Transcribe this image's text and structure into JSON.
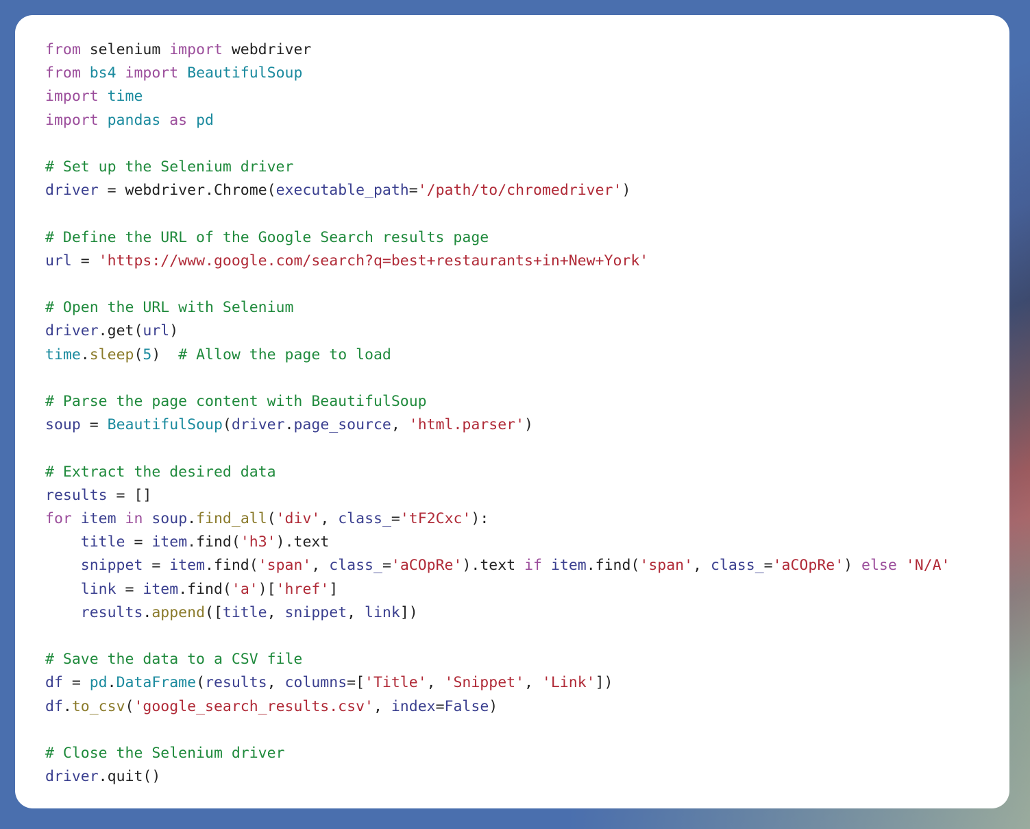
{
  "card": {
    "language": "python",
    "background_color": "#ffffff",
    "corner_radius_px": 26
  },
  "theme": {
    "comment_color": "#1f8a3c",
    "keyword_color": "#9b4d9b",
    "module_color": "#1a8a9e",
    "variable_color": "#3a3f8f",
    "string_color": "#b02a37",
    "function_color": "#8a7a2a",
    "kwarg_color": "#3a3f8f",
    "plain_color": "#222222",
    "page_gradient_start": "#4a6fae",
    "page_gradient_mid": "#9b5a5e",
    "page_gradient_end": "#9aab9e"
  },
  "code": {
    "lines": [
      {
        "id": "l1",
        "tokens": [
          {
            "t": "from ",
            "c": "kw"
          },
          {
            "t": "selenium ",
            "c": "pl"
          },
          {
            "t": "import ",
            "c": "kw"
          },
          {
            "t": "webdriver",
            "c": "pl"
          }
        ]
      },
      {
        "id": "l2",
        "tokens": [
          {
            "t": "from ",
            "c": "kw"
          },
          {
            "t": "bs4 ",
            "c": "mod"
          },
          {
            "t": "import ",
            "c": "kw"
          },
          {
            "t": "BeautifulSoup",
            "c": "mod"
          }
        ]
      },
      {
        "id": "l3",
        "tokens": [
          {
            "t": "import ",
            "c": "kw"
          },
          {
            "t": "time",
            "c": "mod"
          }
        ]
      },
      {
        "id": "l4",
        "tokens": [
          {
            "t": "import ",
            "c": "kw"
          },
          {
            "t": "pandas ",
            "c": "mod"
          },
          {
            "t": "as ",
            "c": "kw"
          },
          {
            "t": "pd",
            "c": "mod"
          }
        ]
      },
      {
        "id": "l5",
        "tokens": []
      },
      {
        "id": "l6",
        "tokens": [
          {
            "t": "# Set up the Selenium driver",
            "c": "cm"
          }
        ]
      },
      {
        "id": "l7",
        "tokens": [
          {
            "t": "driver",
            "c": "var"
          },
          {
            "t": " = ",
            "c": "pl"
          },
          {
            "t": "webdriver",
            "c": "pl"
          },
          {
            "t": ".",
            "c": "pl"
          },
          {
            "t": "Chrome",
            "c": "pl"
          },
          {
            "t": "(",
            "c": "pl"
          },
          {
            "t": "executable_path",
            "c": "kwa"
          },
          {
            "t": "=",
            "c": "pl"
          },
          {
            "t": "'/path/to/chromedriver'",
            "c": "str"
          },
          {
            "t": ")",
            "c": "pl"
          }
        ]
      },
      {
        "id": "l8",
        "tokens": []
      },
      {
        "id": "l9",
        "tokens": [
          {
            "t": "# Define the URL of the Google Search results page",
            "c": "cm"
          }
        ]
      },
      {
        "id": "l10",
        "tokens": [
          {
            "t": "url",
            "c": "var"
          },
          {
            "t": " = ",
            "c": "pl"
          },
          {
            "t": "'https://www.google.com/search?q=best+restaurants+in+New+York'",
            "c": "str"
          }
        ]
      },
      {
        "id": "l11",
        "tokens": []
      },
      {
        "id": "l12",
        "tokens": [
          {
            "t": "# Open the URL with Selenium",
            "c": "cm"
          }
        ]
      },
      {
        "id": "l13",
        "tokens": [
          {
            "t": "driver",
            "c": "var"
          },
          {
            "t": ".",
            "c": "pl"
          },
          {
            "t": "get",
            "c": "pl"
          },
          {
            "t": "(",
            "c": "pl"
          },
          {
            "t": "url",
            "c": "var"
          },
          {
            "t": ")",
            "c": "pl"
          }
        ]
      },
      {
        "id": "l14",
        "tokens": [
          {
            "t": "time",
            "c": "mod"
          },
          {
            "t": ".",
            "c": "pl"
          },
          {
            "t": "sleep",
            "c": "fn"
          },
          {
            "t": "(",
            "c": "pl"
          },
          {
            "t": "5",
            "c": "mod"
          },
          {
            "t": ")",
            "c": "pl"
          },
          {
            "t": "  ",
            "c": "pl"
          },
          {
            "t": "# Allow the page to load",
            "c": "cm"
          }
        ]
      },
      {
        "id": "l15",
        "tokens": []
      },
      {
        "id": "l16",
        "tokens": [
          {
            "t": "# Parse the page content with BeautifulSoup",
            "c": "cm"
          }
        ]
      },
      {
        "id": "l17",
        "tokens": [
          {
            "t": "soup",
            "c": "var"
          },
          {
            "t": " = ",
            "c": "pl"
          },
          {
            "t": "BeautifulSoup",
            "c": "mod"
          },
          {
            "t": "(",
            "c": "pl"
          },
          {
            "t": "driver",
            "c": "var"
          },
          {
            "t": ".",
            "c": "pl"
          },
          {
            "t": "page_source",
            "c": "var"
          },
          {
            "t": ", ",
            "c": "pl"
          },
          {
            "t": "'html.parser'",
            "c": "str"
          },
          {
            "t": ")",
            "c": "pl"
          }
        ]
      },
      {
        "id": "l18",
        "tokens": []
      },
      {
        "id": "l19",
        "tokens": [
          {
            "t": "# Extract the desired data",
            "c": "cm"
          }
        ]
      },
      {
        "id": "l20",
        "tokens": [
          {
            "t": "results",
            "c": "var"
          },
          {
            "t": " = []",
            "c": "pl"
          }
        ]
      },
      {
        "id": "l21",
        "tokens": [
          {
            "t": "for ",
            "c": "kw"
          },
          {
            "t": "item",
            "c": "var"
          },
          {
            "t": " ",
            "c": "pl"
          },
          {
            "t": "in ",
            "c": "kw"
          },
          {
            "t": "soup",
            "c": "var"
          },
          {
            "t": ".",
            "c": "pl"
          },
          {
            "t": "find_all",
            "c": "fn"
          },
          {
            "t": "(",
            "c": "pl"
          },
          {
            "t": "'div'",
            "c": "str"
          },
          {
            "t": ", ",
            "c": "pl"
          },
          {
            "t": "class_",
            "c": "kwa"
          },
          {
            "t": "=",
            "c": "pl"
          },
          {
            "t": "'tF2Cxc'",
            "c": "str"
          },
          {
            "t": "):",
            "c": "pl"
          }
        ]
      },
      {
        "id": "l22",
        "tokens": [
          {
            "t": "    ",
            "c": "pl"
          },
          {
            "t": "title",
            "c": "var"
          },
          {
            "t": " = ",
            "c": "pl"
          },
          {
            "t": "item",
            "c": "var"
          },
          {
            "t": ".",
            "c": "pl"
          },
          {
            "t": "find",
            "c": "pl"
          },
          {
            "t": "(",
            "c": "pl"
          },
          {
            "t": "'h3'",
            "c": "str"
          },
          {
            "t": ")",
            "c": "pl"
          },
          {
            "t": ".",
            "c": "pl"
          },
          {
            "t": "text",
            "c": "pl"
          }
        ]
      },
      {
        "id": "l23",
        "tokens": [
          {
            "t": "    ",
            "c": "pl"
          },
          {
            "t": "snippet",
            "c": "var"
          },
          {
            "t": " = ",
            "c": "pl"
          },
          {
            "t": "item",
            "c": "var"
          },
          {
            "t": ".",
            "c": "pl"
          },
          {
            "t": "find",
            "c": "pl"
          },
          {
            "t": "(",
            "c": "pl"
          },
          {
            "t": "'span'",
            "c": "str"
          },
          {
            "t": ", ",
            "c": "pl"
          },
          {
            "t": "class_",
            "c": "kwa"
          },
          {
            "t": "=",
            "c": "pl"
          },
          {
            "t": "'aCOpRe'",
            "c": "str"
          },
          {
            "t": ")",
            "c": "pl"
          },
          {
            "t": ".",
            "c": "pl"
          },
          {
            "t": "text ",
            "c": "pl"
          },
          {
            "t": "if ",
            "c": "kw"
          },
          {
            "t": "item",
            "c": "var"
          },
          {
            "t": ".",
            "c": "pl"
          },
          {
            "t": "find",
            "c": "pl"
          },
          {
            "t": "(",
            "c": "pl"
          },
          {
            "t": "'span'",
            "c": "str"
          },
          {
            "t": ", ",
            "c": "pl"
          },
          {
            "t": "class_",
            "c": "kwa"
          },
          {
            "t": "=",
            "c": "pl"
          },
          {
            "t": "'aCOpRe'",
            "c": "str"
          },
          {
            "t": ") ",
            "c": "pl"
          },
          {
            "t": "else ",
            "c": "kw"
          },
          {
            "t": "'N/A'",
            "c": "str"
          }
        ]
      },
      {
        "id": "l24",
        "tokens": [
          {
            "t": "    ",
            "c": "pl"
          },
          {
            "t": "link",
            "c": "var"
          },
          {
            "t": " = ",
            "c": "pl"
          },
          {
            "t": "item",
            "c": "var"
          },
          {
            "t": ".",
            "c": "pl"
          },
          {
            "t": "find",
            "c": "pl"
          },
          {
            "t": "(",
            "c": "pl"
          },
          {
            "t": "'a'",
            "c": "str"
          },
          {
            "t": ")[",
            "c": "pl"
          },
          {
            "t": "'href'",
            "c": "str"
          },
          {
            "t": "]",
            "c": "pl"
          }
        ]
      },
      {
        "id": "l25",
        "tokens": [
          {
            "t": "    ",
            "c": "pl"
          },
          {
            "t": "results",
            "c": "var"
          },
          {
            "t": ".",
            "c": "pl"
          },
          {
            "t": "append",
            "c": "fn"
          },
          {
            "t": "([",
            "c": "pl"
          },
          {
            "t": "title",
            "c": "var"
          },
          {
            "t": ", ",
            "c": "pl"
          },
          {
            "t": "snippet",
            "c": "var"
          },
          {
            "t": ", ",
            "c": "pl"
          },
          {
            "t": "link",
            "c": "var"
          },
          {
            "t": "])",
            "c": "pl"
          }
        ]
      },
      {
        "id": "l26",
        "tokens": []
      },
      {
        "id": "l27",
        "tokens": [
          {
            "t": "# Save the data to a CSV file",
            "c": "cm"
          }
        ]
      },
      {
        "id": "l28",
        "tokens": [
          {
            "t": "df",
            "c": "var"
          },
          {
            "t": " = ",
            "c": "pl"
          },
          {
            "t": "pd",
            "c": "mod"
          },
          {
            "t": ".",
            "c": "pl"
          },
          {
            "t": "DataFrame",
            "c": "mod"
          },
          {
            "t": "(",
            "c": "pl"
          },
          {
            "t": "results",
            "c": "var"
          },
          {
            "t": ", ",
            "c": "pl"
          },
          {
            "t": "columns",
            "c": "kwa"
          },
          {
            "t": "=[",
            "c": "pl"
          },
          {
            "t": "'Title'",
            "c": "str"
          },
          {
            "t": ", ",
            "c": "pl"
          },
          {
            "t": "'Snippet'",
            "c": "str"
          },
          {
            "t": ", ",
            "c": "pl"
          },
          {
            "t": "'Link'",
            "c": "str"
          },
          {
            "t": "])",
            "c": "pl"
          }
        ]
      },
      {
        "id": "l29",
        "tokens": [
          {
            "t": "df",
            "c": "var"
          },
          {
            "t": ".",
            "c": "pl"
          },
          {
            "t": "to_csv",
            "c": "fn"
          },
          {
            "t": "(",
            "c": "pl"
          },
          {
            "t": "'google_search_results.csv'",
            "c": "str"
          },
          {
            "t": ", ",
            "c": "pl"
          },
          {
            "t": "index",
            "c": "kwa"
          },
          {
            "t": "=",
            "c": "pl"
          },
          {
            "t": "False",
            "c": "kwa"
          },
          {
            "t": ")",
            "c": "pl"
          }
        ]
      },
      {
        "id": "l30",
        "tokens": []
      },
      {
        "id": "l31",
        "tokens": [
          {
            "t": "# Close the Selenium driver",
            "c": "cm"
          }
        ]
      },
      {
        "id": "l32",
        "tokens": [
          {
            "t": "driver",
            "c": "var"
          },
          {
            "t": ".",
            "c": "pl"
          },
          {
            "t": "quit",
            "c": "pl"
          },
          {
            "t": "()",
            "c": "pl"
          }
        ]
      }
    ],
    "plain_text": "from selenium import webdriver\nfrom bs4 import BeautifulSoup\nimport time\nimport pandas as pd\n\n# Set up the Selenium driver\ndriver = webdriver.Chrome(executable_path='/path/to/chromedriver')\n\n# Define the URL of the Google Search results page\nurl = 'https://www.google.com/search?q=best+restaurants+in+New+York'\n\n# Open the URL with Selenium\ndriver.get(url)\ntime.sleep(5)  # Allow the page to load\n\n# Parse the page content with BeautifulSoup\nsoup = BeautifulSoup(driver.page_source, 'html.parser')\n\n# Extract the desired data\nresults = []\nfor item in soup.find_all('div', class_='tF2Cxc'):\n    title = item.find('h3').text\n    snippet = item.find('span', class_='aCOpRe').text if item.find('span', class_='aCOpRe') else 'N/A'\n    link = item.find('a')['href']\n    results.append([title, snippet, link])\n\n# Save the data to a CSV file\ndf = pd.DataFrame(results, columns=['Title', 'Snippet', 'Link'])\ndf.to_csv('google_search_results.csv', index=False)\n\n# Close the Selenium driver\ndriver.quit()"
  }
}
